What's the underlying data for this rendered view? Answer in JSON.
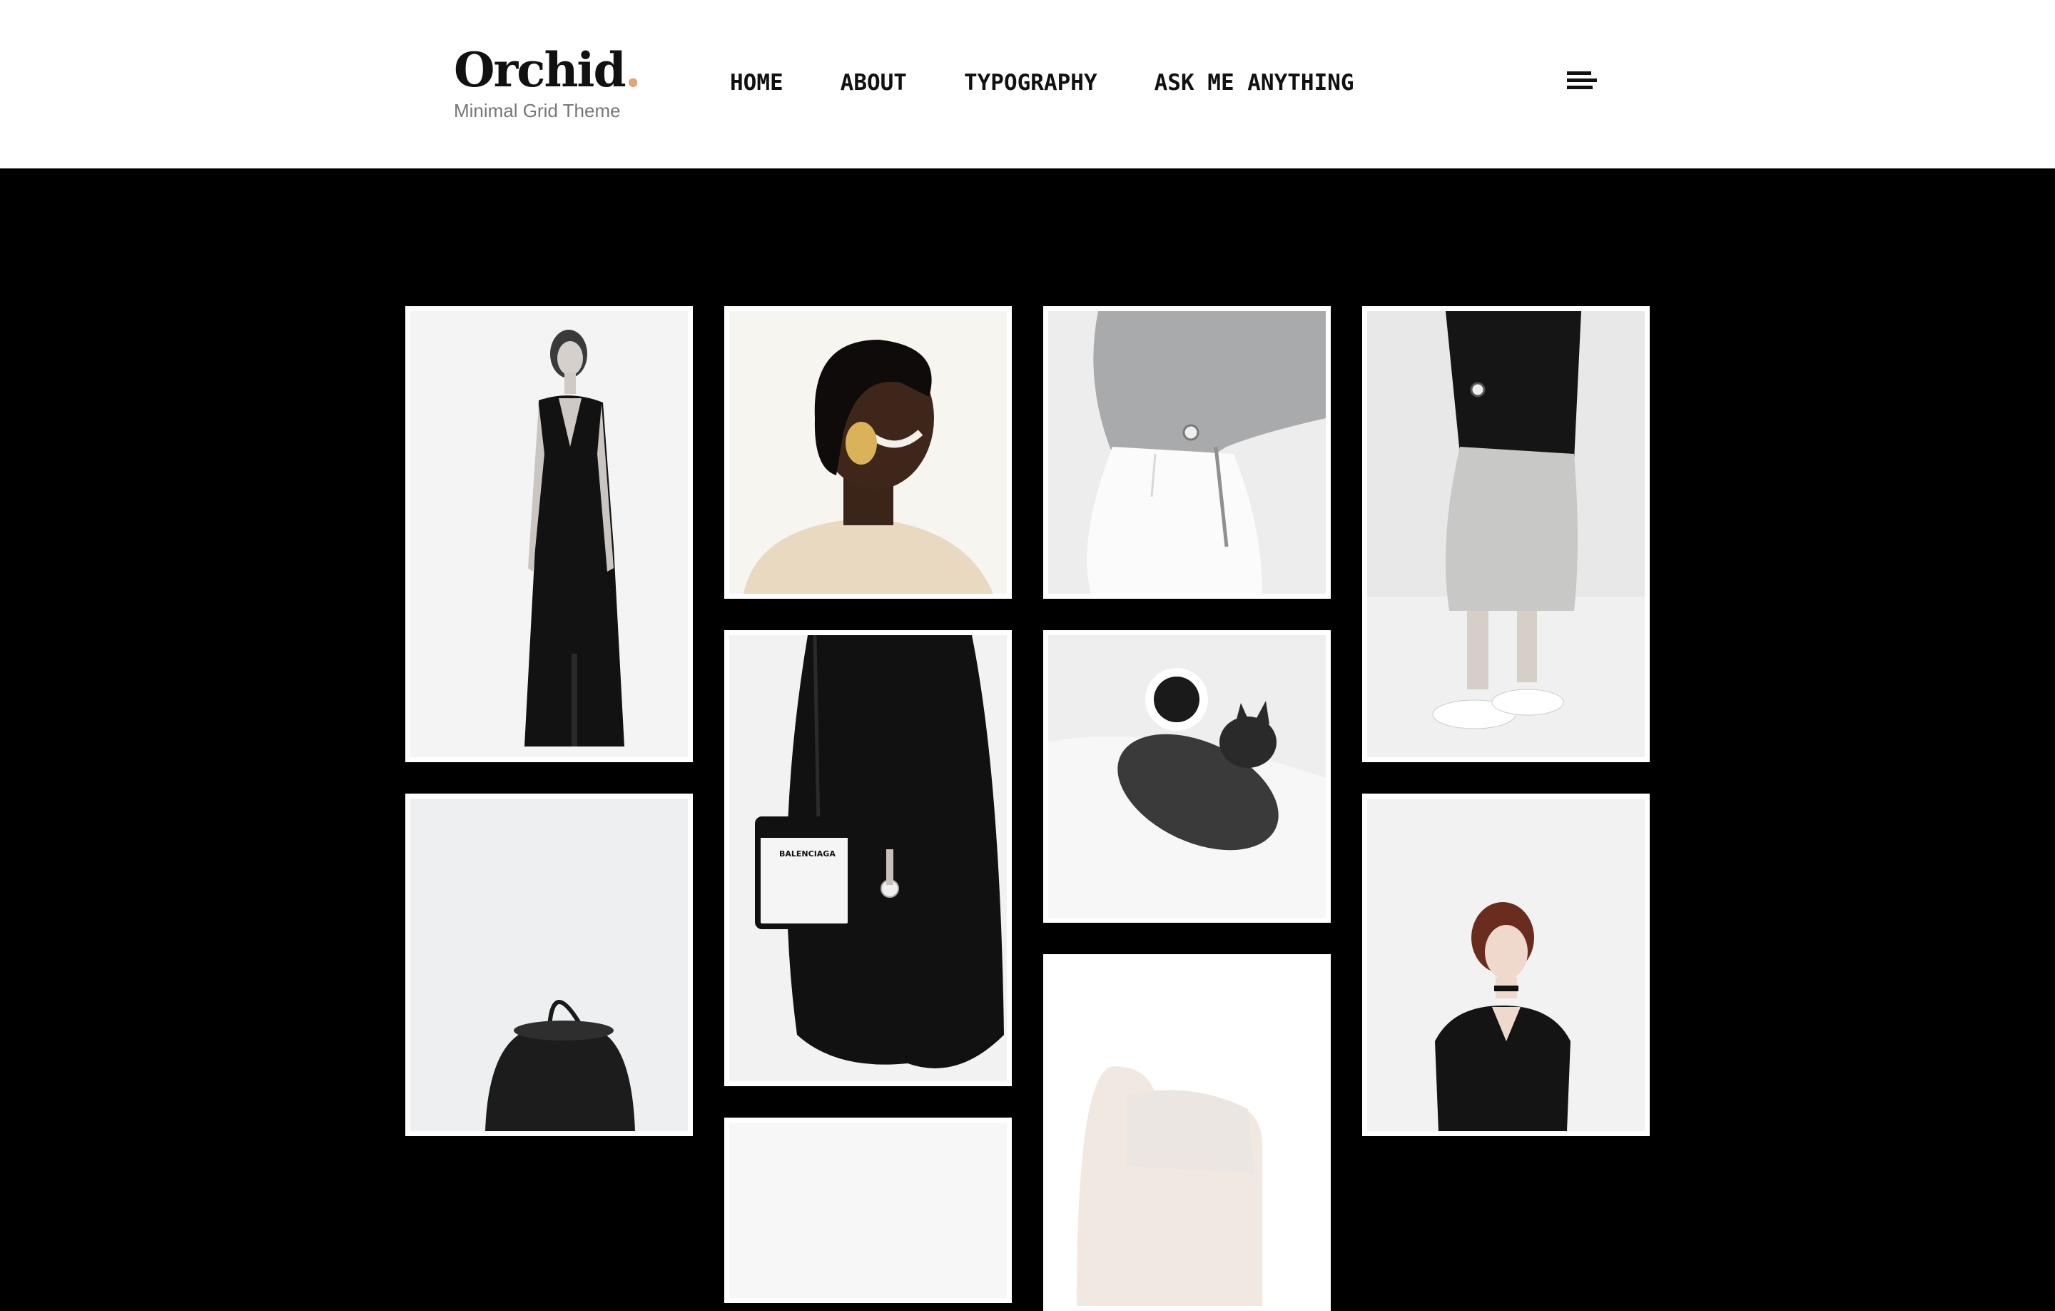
{
  "site": {
    "logo_text": "Orchid",
    "logo_dot": ".",
    "tagline": "Minimal Grid Theme"
  },
  "nav": {
    "items": [
      {
        "label": "HOME"
      },
      {
        "label": "ABOUT"
      },
      {
        "label": "TYPOGRAPHY"
      },
      {
        "label": "ASK ME ANYTHING"
      }
    ]
  },
  "menu": {
    "icon": "menu-lines-icon"
  },
  "colors": {
    "accent": "#e0a57c",
    "background": "#000000",
    "header_bg": "#ffffff",
    "text": "#111111",
    "tagline": "#777777"
  },
  "gallery": {
    "items": [
      {
        "subject": "woman-black-dress-photo"
      },
      {
        "subject": "woman-gold-earring-photo"
      },
      {
        "subject": "grey-sweater-white-jeans-photo"
      },
      {
        "subject": "white-culottes-sneakers-photo"
      },
      {
        "subject": "black-coat-bag-photo"
      },
      {
        "subject": "cat-coffee-photo"
      },
      {
        "subject": "black-bucket-bag-photo"
      },
      {
        "subject": "hand-knit-sleeve-photo"
      },
      {
        "subject": "woman-black-tshirt-photo"
      },
      {
        "subject": "partial-photo"
      }
    ]
  }
}
